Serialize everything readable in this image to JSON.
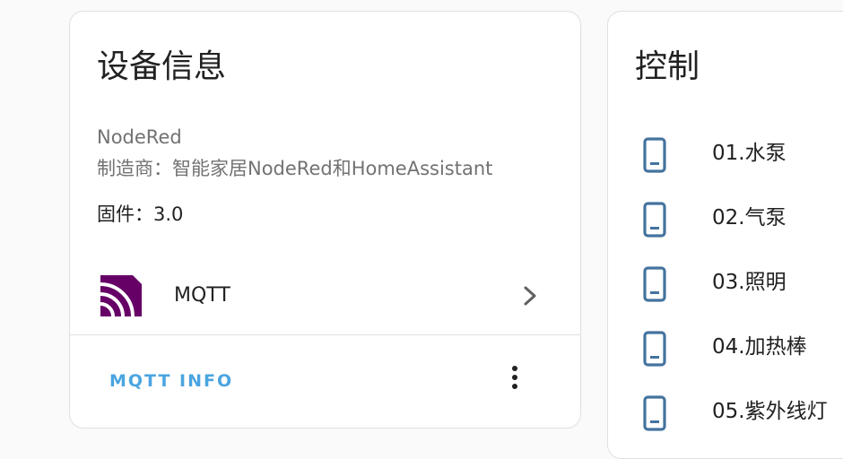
{
  "device_card": {
    "title": "设备信息",
    "name": "NodeRed",
    "manufacturer_line": "制造商：智能家居NodeRed和HomeAssistant",
    "firmware_line": "固件：3.0",
    "integration": {
      "label": "MQTT",
      "icon": "mqtt-logo-icon"
    },
    "action_label": "MQTT INFO",
    "colors": {
      "accent": "#4aa5e0",
      "mqtt_logo": "#660066"
    }
  },
  "control_card": {
    "title": "控制",
    "entities": [
      {
        "label": "01.水泵",
        "icon": "cellphone-icon"
      },
      {
        "label": "02.气泵",
        "icon": "cellphone-icon"
      },
      {
        "label": "03.照明",
        "icon": "cellphone-icon"
      },
      {
        "label": "04.加热棒",
        "icon": "cellphone-icon"
      },
      {
        "label": "05.紫外线灯",
        "icon": "cellphone-icon"
      }
    ],
    "colors": {
      "icon": "#44739e"
    }
  }
}
